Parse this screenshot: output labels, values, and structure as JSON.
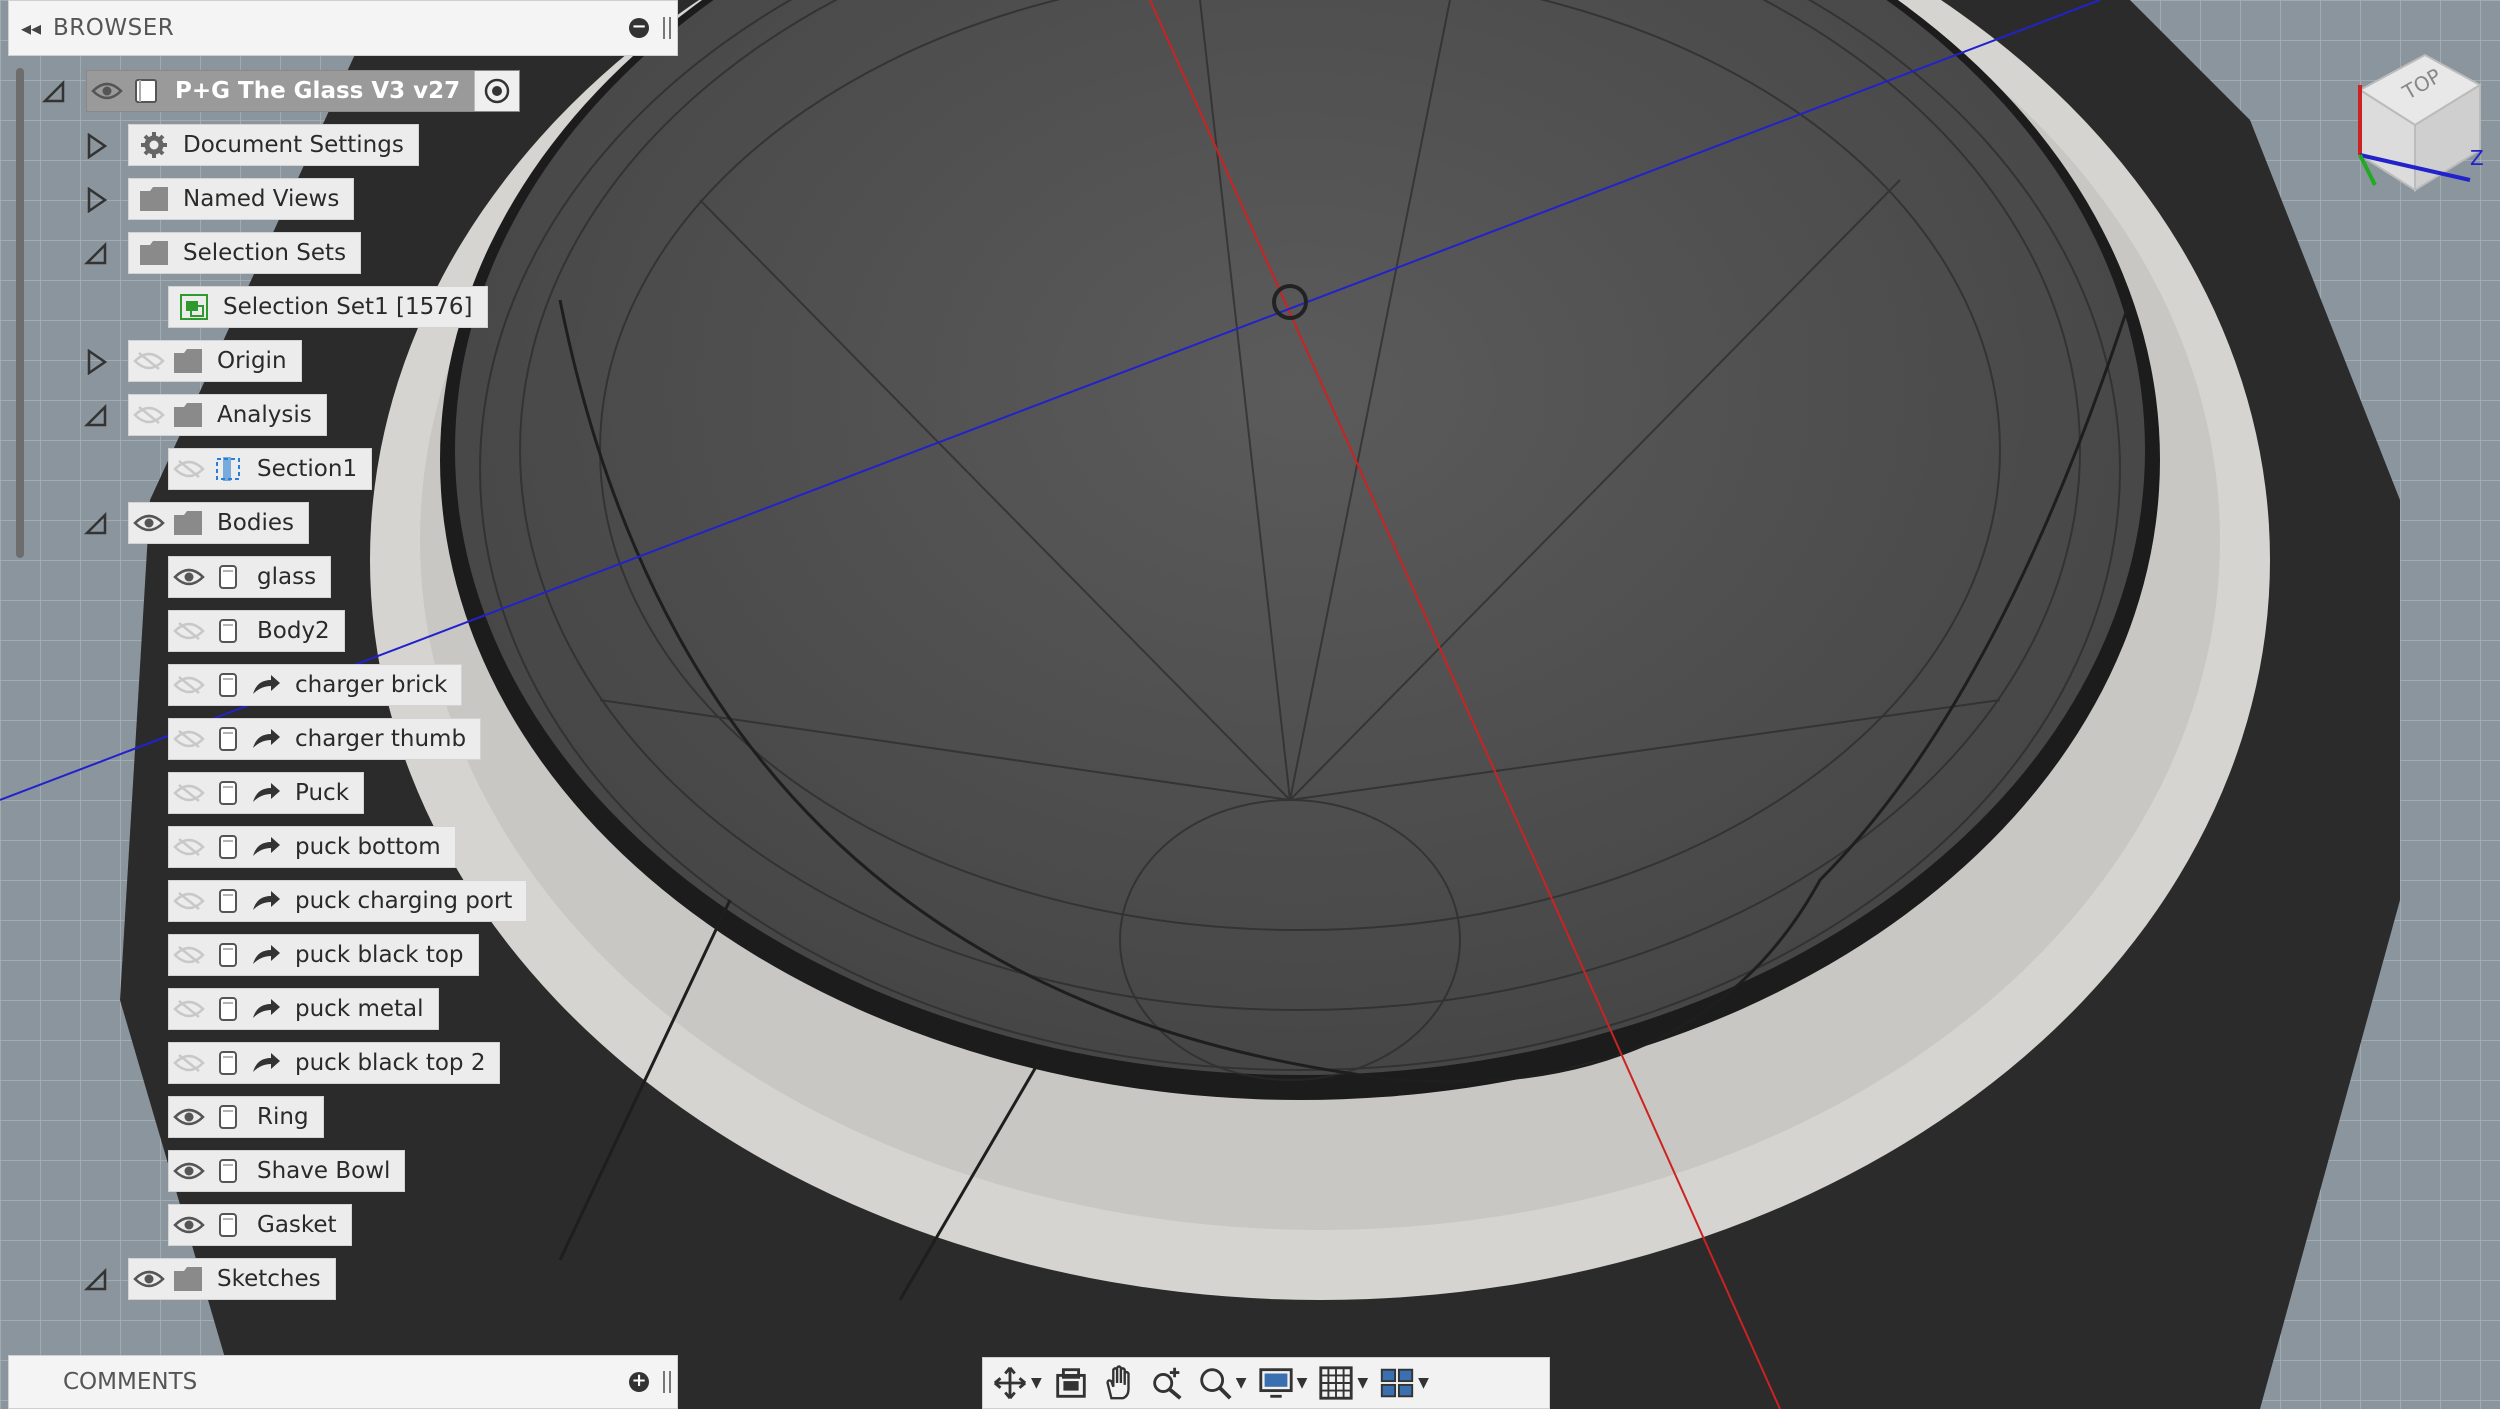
{
  "browser": {
    "title": "BROWSER",
    "root": {
      "label": "P+G The Glass V3 v27"
    },
    "items": [
      {
        "label": "Document Settings"
      },
      {
        "label": "Named Views"
      },
      {
        "label": "Selection Sets"
      },
      {
        "label": "Selection Set1 [1576]"
      },
      {
        "label": "Origin"
      },
      {
        "label": "Analysis"
      },
      {
        "label": "Section1"
      },
      {
        "label": "Bodies"
      },
      {
        "label": "glass"
      },
      {
        "label": "Body2"
      },
      {
        "label": "charger brick"
      },
      {
        "label": "charger thumb"
      },
      {
        "label": "Puck"
      },
      {
        "label": "puck bottom"
      },
      {
        "label": "puck charging port"
      },
      {
        "label": "puck black top"
      },
      {
        "label": "puck metal"
      },
      {
        "label": "puck black top 2"
      },
      {
        "label": "Ring"
      },
      {
        "label": "Shave Bowl"
      },
      {
        "label": "Gasket"
      },
      {
        "label": "Sketches"
      }
    ]
  },
  "comments": {
    "title": "COMMENTS"
  },
  "viewcube": {
    "face_label": "TOP",
    "axis_z": "Z"
  },
  "toolbar": {
    "icons": [
      "orbit-icon",
      "look-at-icon",
      "pan-icon",
      "zoom-icon",
      "fit-icon",
      "display-settings-icon",
      "grid-icon",
      "viewports-icon"
    ]
  },
  "colors": {
    "panel_bg": "#ececec",
    "root_bg": "#9a9a9a",
    "axis_red": "#c22",
    "axis_blue": "#22c",
    "folder_gray": "#8a8a8a",
    "selection_green": "#2e9a2e",
    "section_blue": "#2a7fd4"
  }
}
